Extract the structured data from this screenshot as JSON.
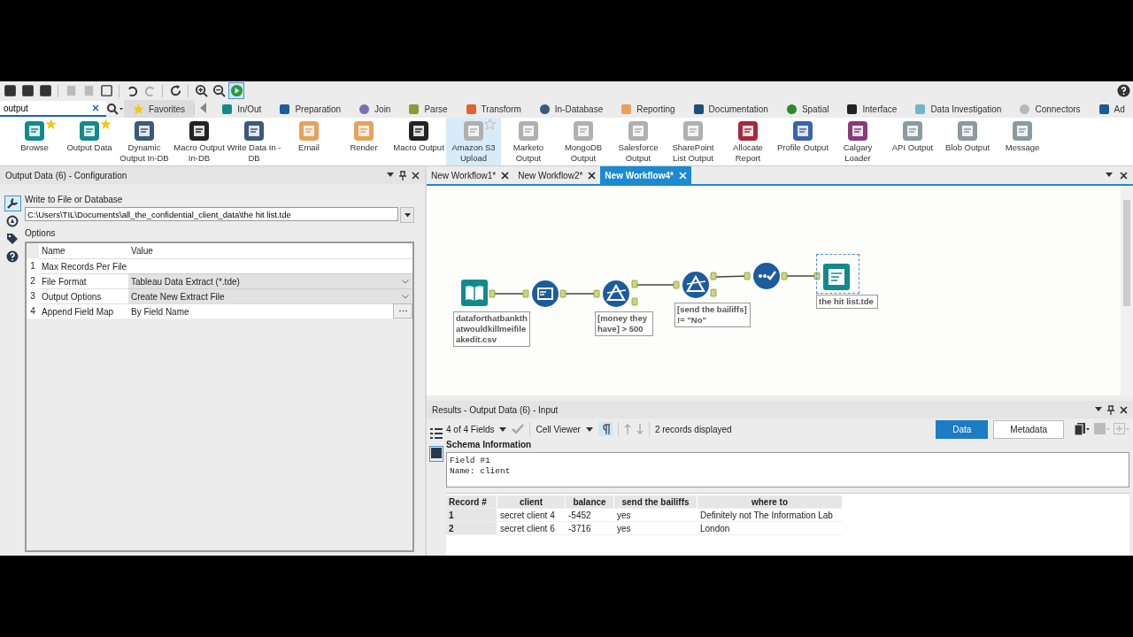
{
  "search": {
    "value": "output"
  },
  "categories": [
    {
      "label": "Favorites",
      "selected": true,
      "color": "#f5c518"
    },
    {
      "label": "In/Out",
      "selected": false,
      "color": "#138a8a"
    },
    {
      "label": "Preparation",
      "selected": false,
      "color": "#1c5b9c"
    },
    {
      "label": "Join",
      "selected": false,
      "color": "#7b6fb0"
    },
    {
      "label": "Parse",
      "selected": false,
      "color": "#8c9a3c"
    },
    {
      "label": "Transform",
      "selected": false,
      "color": "#e0622c"
    },
    {
      "label": "In-Database",
      "selected": false,
      "color": "#3b5a7a"
    },
    {
      "label": "Reporting",
      "selected": false,
      "color": "#e8a15a"
    },
    {
      "label": "Documentation",
      "selected": false,
      "color": "#1f4e79"
    },
    {
      "label": "Spatial",
      "selected": false,
      "color": "#2a8a2a"
    },
    {
      "label": "Interface",
      "selected": false,
      "color": "#222222"
    },
    {
      "label": "Data Investigation",
      "selected": false,
      "color": "#6fb8c8"
    },
    {
      "label": "Connectors",
      "selected": false,
      "color": "#b8b8b8"
    },
    {
      "label": "Ad",
      "selected": false,
      "color": "#1a5a9a"
    }
  ],
  "tools": [
    {
      "label": "Browse",
      "favorite": true,
      "selected": false,
      "color": "#138a8a"
    },
    {
      "label": "Output Data",
      "favorite": true,
      "selected": false,
      "color": "#138a8a"
    },
    {
      "label": "Dynamic Output In-DB",
      "favorite": false,
      "selected": false,
      "color": "#3b5a7a"
    },
    {
      "label": "Macro Output In-DB",
      "favorite": false,
      "selected": false,
      "color": "#222222"
    },
    {
      "label": "Write Data In -DB",
      "favorite": false,
      "selected": false,
      "color": "#3b5a7a"
    },
    {
      "label": "Email",
      "favorite": false,
      "selected": false,
      "color": "#e8a15a"
    },
    {
      "label": "Render",
      "favorite": false,
      "selected": false,
      "color": "#e8a15a"
    },
    {
      "label": "Macro Output",
      "favorite": false,
      "selected": false,
      "color": "#222222"
    },
    {
      "label": "Amazon S3 Upload",
      "favorite": false,
      "selected": true,
      "color": "#b0b0b0"
    },
    {
      "label": "Marketo Output",
      "favorite": false,
      "selected": false,
      "color": "#b0b0b0"
    },
    {
      "label": "MongoDB Output",
      "favorite": false,
      "selected": false,
      "color": "#b0b0b0"
    },
    {
      "label": "Salesforce Output",
      "favorite": false,
      "selected": false,
      "color": "#b0b0b0"
    },
    {
      "label": "SharePoint List Output",
      "favorite": false,
      "selected": false,
      "color": "#b0b0b0"
    },
    {
      "label": "Allocate Report",
      "favorite": false,
      "selected": false,
      "color": "#a8283a"
    },
    {
      "label": "Profile Output",
      "favorite": false,
      "selected": false,
      "color": "#3a64b0"
    },
    {
      "label": "Calgary Loader",
      "favorite": false,
      "selected": false,
      "color": "#8a3a7a"
    },
    {
      "label": "API Output",
      "favorite": false,
      "selected": false,
      "color": "#8a9aa0"
    },
    {
      "label": "Blob Output",
      "favorite": false,
      "selected": false,
      "color": "#8a9aa0"
    },
    {
      "label": "Message",
      "favorite": false,
      "selected": false,
      "color": "#8a9aa0"
    }
  ],
  "config": {
    "title": "Output Data (6) - Configuration",
    "field_label": "Write to File or Database",
    "path": "C:\\Users\\TIL\\Documents\\all_the_confidential_client_data\\the hit list.tde",
    "options_label": "Options",
    "columns": [
      "Name",
      "Value"
    ],
    "rows": [
      {
        "num": "1",
        "name": "Max Records Per File",
        "kind": "text"
      },
      {
        "num": "2",
        "name": "File Format",
        "value": "Tableau Data Extract (*.tde)",
        "kind": "dropdown"
      },
      {
        "num": "3",
        "name": "Output Options",
        "value": "Create New Extract File",
        "kind": "dropdown"
      },
      {
        "num": "4",
        "name": "Append Field Map",
        "value": "By Field Name",
        "kind": "browse"
      }
    ]
  },
  "workflow_tabs": [
    {
      "label": "New Workflow1*",
      "selected": false
    },
    {
      "label": "New Workflow2*",
      "selected": false
    },
    {
      "label": "New Workflow4*",
      "selected": true
    }
  ],
  "canvas": {
    "nodes": [
      {
        "kind": "input",
        "label": "dataforthatbankthatwouldkillmeifileakedit.csv"
      },
      {
        "kind": "select"
      },
      {
        "kind": "filter",
        "label": "[money they have] > 500"
      },
      {
        "kind": "filter",
        "label": "[send the bailiffs] != \"No\""
      },
      {
        "kind": "formula"
      },
      {
        "kind": "output",
        "label": "the hit list.tde",
        "selected": true
      }
    ]
  },
  "results": {
    "title": "Results - Output Data (6) - Input",
    "fields": "4 of 4 Fields",
    "viewer": "Cell Viewer",
    "records": "2 records displayed",
    "views": [
      {
        "label": "Data",
        "selected": true
      },
      {
        "label": "Metadata",
        "selected": false
      }
    ],
    "schema_heading": "Schema Information",
    "schema_lines": [
      "Field #1",
      "Name: client"
    ],
    "columns": [
      "Record #",
      "client",
      "balance",
      "send the bailiffs",
      "where to"
    ],
    "rows": [
      [
        "1",
        "secret client 4",
        "-5452",
        "yes",
        "Definitely not The Information Lab"
      ],
      [
        "2",
        "secret client 6",
        "-3716",
        "yes",
        "London"
      ]
    ]
  }
}
